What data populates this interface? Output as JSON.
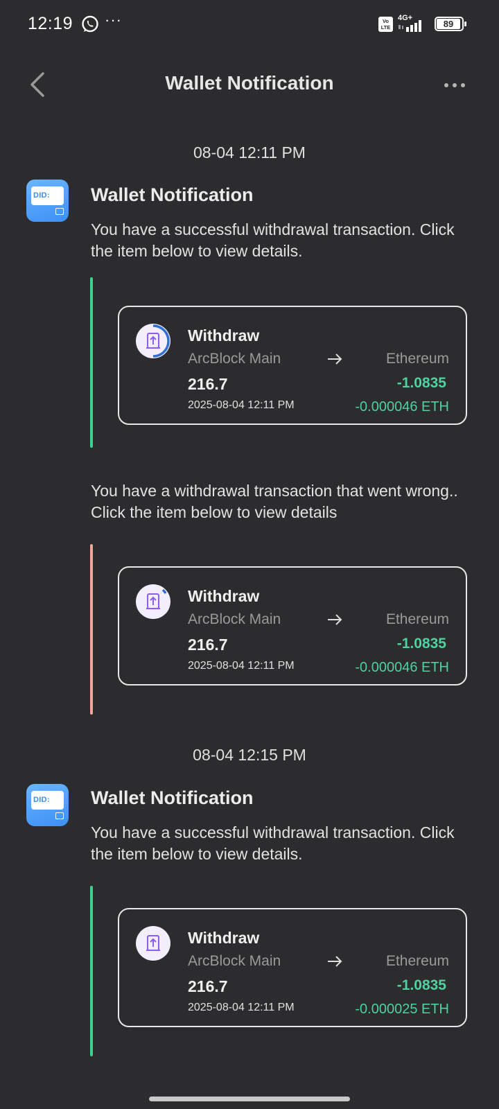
{
  "status_bar": {
    "time": "12:19",
    "notification_icons": [
      "whatsapp-icon"
    ],
    "overflow": "···",
    "volte": "Vo LTE",
    "network_type": "4G+",
    "battery": "89"
  },
  "header": {
    "title": "Wallet Notification",
    "back_icon": "chevron-left-icon",
    "more_icon": "more-horizontal-icon"
  },
  "colors": {
    "background": "#2c2c2e",
    "success_bar": "#3fd093",
    "error_bar": "#f0a69a",
    "positive_amount": "#4fd1a0",
    "muted_text": "#9a9a9a"
  },
  "groups": [
    {
      "timestamp": "08-04 12:11 PM",
      "sender": "Wallet Notification",
      "app_icon_text": "DID:",
      "messages": [
        {
          "text": "You have a successful withdrawal transaction. Click the item below to view details.",
          "status": "success",
          "tx": {
            "type": "Withdraw",
            "from": "ArcBlock Main",
            "to": "Ethereum",
            "amount": "216.7",
            "change": "-1.0835",
            "time": "2025-08-04 12:11 PM",
            "fee": "-0.000046 ETH"
          }
        },
        {
          "text": "You have a withdrawal transaction that went wrong.. Click the item below to view details",
          "status": "error",
          "tx": {
            "type": "Withdraw",
            "from": "ArcBlock Main",
            "to": "Ethereum",
            "amount": "216.7",
            "change": "-1.0835",
            "time": "2025-08-04 12:11 PM",
            "fee": "-0.000046 ETH"
          }
        }
      ]
    },
    {
      "timestamp": "08-04 12:15 PM",
      "sender": "Wallet Notification",
      "app_icon_text": "DID:",
      "messages": [
        {
          "text": "You have a successful withdrawal transaction. Click the item below to view details.",
          "status": "success",
          "tx": {
            "type": "Withdraw",
            "from": "ArcBlock Main",
            "to": "Ethereum",
            "amount": "216.7",
            "change": "-1.0835",
            "time": "2025-08-04 12:11 PM",
            "fee": "-0.000025 ETH"
          }
        }
      ]
    }
  ]
}
